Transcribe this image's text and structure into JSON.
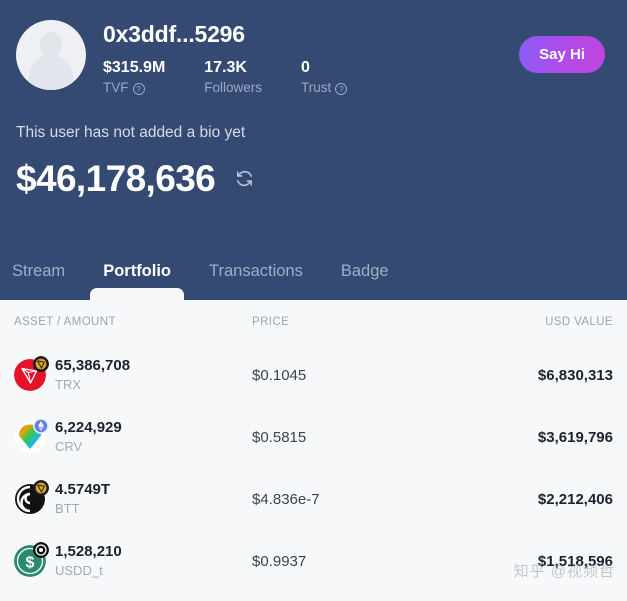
{
  "profile": {
    "handle": "0x3ddf...5296",
    "avatar_icon": "default-user-avatar",
    "say_hi_label": "Say Hi",
    "bio": "This user has not added a bio yet",
    "net_worth": "$46,178,636",
    "refresh_icon": "refresh-icon",
    "stats": [
      {
        "value": "$315.9M",
        "label": "TVF",
        "has_help": true
      },
      {
        "value": "17.3K",
        "label": "Followers",
        "has_help": false
      },
      {
        "value": "0",
        "label": "Trust",
        "has_help": true
      }
    ]
  },
  "tabs": [
    {
      "label": "Stream",
      "active": false
    },
    {
      "label": "Portfolio",
      "active": true
    },
    {
      "label": "Transactions",
      "active": false
    },
    {
      "label": "Badge",
      "active": false
    }
  ],
  "table": {
    "columns": {
      "asset": "ASSET / AMOUNT",
      "price": "PRICE",
      "value": "USD VALUE"
    },
    "rows": [
      {
        "amount": "65,386,708",
        "symbol": "TRX",
        "price": "$0.1045",
        "usd_value": "$6,830,313",
        "token_icon": "tron-token-icon",
        "chain_badge": "tron-chain-badge"
      },
      {
        "amount": "6,224,929",
        "symbol": "CRV",
        "price": "$0.5815",
        "usd_value": "$3,619,796",
        "token_icon": "curve-token-icon",
        "chain_badge": "ethereum-chain-badge"
      },
      {
        "amount": "4.5749T",
        "symbol": "BTT",
        "price": "$4.836e-7",
        "usd_value": "$2,212,406",
        "token_icon": "bittorrent-token-icon",
        "chain_badge": "tron-chain-badge"
      },
      {
        "amount": "1,528,210",
        "symbol": "USDD_t",
        "price": "$0.9937",
        "usd_value": "$1,518,596",
        "token_icon": "usdd-token-icon",
        "chain_badge": "dark-chain-badge"
      }
    ]
  },
  "watermark": {
    "text": "知乎 @视频哲"
  },
  "colors": {
    "header_bg": "#344a72",
    "panel_bg": "#f7f8fa",
    "accent_button_from": "#8b5cf6",
    "accent_button_to": "#c045e0",
    "muted_text": "#9aa8c4"
  }
}
